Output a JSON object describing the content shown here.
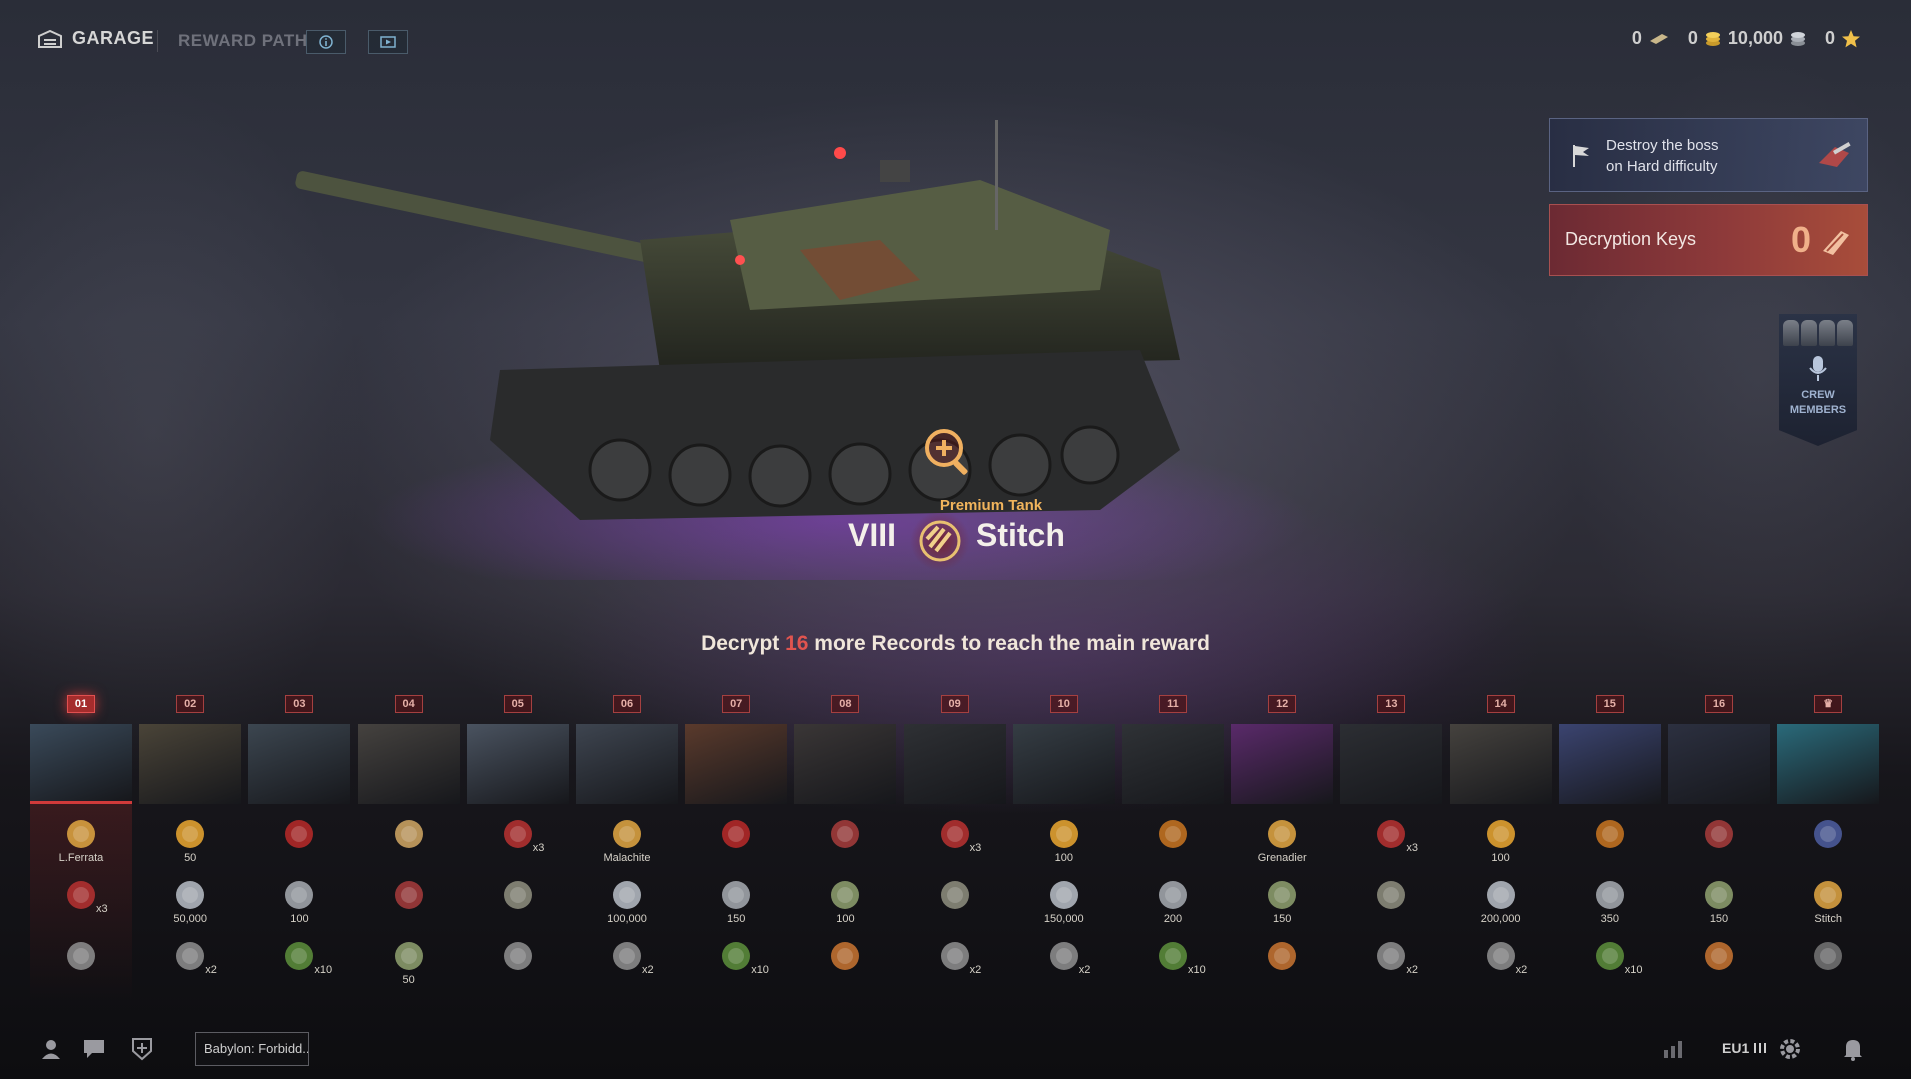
{
  "topbar": {
    "garage_label": "GARAGE",
    "reward_path_label": "REWARD PATH",
    "info_icon": "info-icon",
    "video_icon": "video-icon",
    "currencies": [
      {
        "name": "bonds",
        "value": "0",
        "icon": "bonds-icon"
      },
      {
        "name": "gold",
        "value": "0",
        "icon": "gold-icon"
      },
      {
        "name": "credits",
        "value": "10,000",
        "icon": "credits-icon"
      },
      {
        "name": "free-xp",
        "value": "0",
        "icon": "star-icon"
      }
    ]
  },
  "mission": {
    "text_line1": "Destroy the boss",
    "text_line2": "on Hard difficulty"
  },
  "decryption_keys": {
    "label": "Decryption Keys",
    "value": "0"
  },
  "crew": {
    "label_line1": "CREW",
    "label_line2": "MEMBERS"
  },
  "tank": {
    "kind": "Premium Tank",
    "tier": "VIII",
    "name": "Stitch"
  },
  "decrypt": {
    "prefix": "Decrypt ",
    "count": "16",
    "suffix": " more Records to reach the main reward"
  },
  "path": {
    "active_index": 0,
    "columns": [
      {
        "num": "01",
        "thumb": "#3a4a5a",
        "r1": {
          "icon": "tank-medal",
          "cap": "L.Ferrata",
          "mul": ""
        },
        "r2": {
          "icon": "booster",
          "cap": "",
          "mul": "x3"
        },
        "r3": {
          "icon": "tank-star",
          "cap": "",
          "mul": ""
        }
      },
      {
        "num": "02",
        "thumb": "#4a4438",
        "r1": {
          "icon": "gold-badge",
          "cap": "50",
          "mul": ""
        },
        "r2": {
          "icon": "credits",
          "cap": "50,000",
          "mul": ""
        },
        "r3": {
          "icon": "tank-star",
          "cap": "",
          "mul": "x2"
        }
      },
      {
        "num": "03",
        "thumb": "#3c4650",
        "r1": {
          "icon": "medal-1",
          "cap": "",
          "mul": ""
        },
        "r2": {
          "icon": "gear",
          "cap": "100",
          "mul": ""
        },
        "r3": {
          "icon": "battery",
          "cap": "",
          "mul": "x10"
        }
      },
      {
        "num": "04",
        "thumb": "#45423f",
        "r1": {
          "icon": "portrait",
          "cap": "",
          "mul": ""
        },
        "r2": {
          "icon": "book",
          "cap": "",
          "mul": ""
        },
        "r3": {
          "icon": "cash",
          "cap": "50",
          "mul": ""
        }
      },
      {
        "num": "05",
        "thumb": "#4a5360",
        "r1": {
          "icon": "booster",
          "cap": "",
          "mul": "x3"
        },
        "r2": {
          "icon": "manual",
          "cap": "",
          "mul": ""
        },
        "r3": {
          "icon": "tank-star",
          "cap": "",
          "mul": ""
        }
      },
      {
        "num": "06",
        "thumb": "#3e4550",
        "r1": {
          "icon": "tank-medal",
          "cap": "Malachite",
          "mul": ""
        },
        "r2": {
          "icon": "credits",
          "cap": "100,000",
          "mul": ""
        },
        "r3": {
          "icon": "tank-star",
          "cap": "",
          "mul": "x2"
        }
      },
      {
        "num": "07",
        "thumb": "#5a3a2c",
        "r1": {
          "icon": "medal-1",
          "cap": "",
          "mul": ""
        },
        "r2": {
          "icon": "gear",
          "cap": "150",
          "mul": ""
        },
        "r3": {
          "icon": "battery",
          "cap": "",
          "mul": "x10"
        }
      },
      {
        "num": "08",
        "thumb": "#3a3636",
        "r1": {
          "icon": "book",
          "cap": "",
          "mul": ""
        },
        "r2": {
          "icon": "cash",
          "cap": "100",
          "mul": ""
        },
        "r3": {
          "icon": "decal",
          "cap": "",
          "mul": ""
        }
      },
      {
        "num": "09",
        "thumb": "#2e3034",
        "r1": {
          "icon": "booster",
          "cap": "",
          "mul": "x3"
        },
        "r2": {
          "icon": "manual",
          "cap": "",
          "mul": ""
        },
        "r3": {
          "icon": "tank-star",
          "cap": "",
          "mul": "x2"
        }
      },
      {
        "num": "10",
        "thumb": "#353d44",
        "r1": {
          "icon": "gold-badge",
          "cap": "100",
          "mul": ""
        },
        "r2": {
          "icon": "credits",
          "cap": "150,000",
          "mul": ""
        },
        "r3": {
          "icon": "tank-star",
          "cap": "",
          "mul": "x2"
        }
      },
      {
        "num": "11",
        "thumb": "#2f3236",
        "r1": {
          "icon": "medal-2",
          "cap": "",
          "mul": ""
        },
        "r2": {
          "icon": "gear",
          "cap": "200",
          "mul": ""
        },
        "r3": {
          "icon": "battery",
          "cap": "",
          "mul": "x10"
        }
      },
      {
        "num": "12",
        "thumb": "#5a2a6a",
        "r1": {
          "icon": "tank-medal",
          "cap": "Grenadier",
          "mul": ""
        },
        "r2": {
          "icon": "cash",
          "cap": "150",
          "mul": ""
        },
        "r3": {
          "icon": "decal",
          "cap": "",
          "mul": ""
        }
      },
      {
        "num": "13",
        "thumb": "#2c2e33",
        "r1": {
          "icon": "booster",
          "cap": "",
          "mul": "x3"
        },
        "r2": {
          "icon": "manual",
          "cap": "",
          "mul": ""
        },
        "r3": {
          "icon": "tank-star",
          "cap": "",
          "mul": "x2"
        }
      },
      {
        "num": "14",
        "thumb": "#45423e",
        "r1": {
          "icon": "gold-badge",
          "cap": "100",
          "mul": ""
        },
        "r2": {
          "icon": "credits",
          "cap": "200,000",
          "mul": ""
        },
        "r3": {
          "icon": "tank-star",
          "cap": "",
          "mul": "x2"
        }
      },
      {
        "num": "15",
        "thumb": "#3b4470",
        "r1": {
          "icon": "medal-2",
          "cap": "",
          "mul": ""
        },
        "r2": {
          "icon": "gear",
          "cap": "350",
          "mul": ""
        },
        "r3": {
          "icon": "battery",
          "cap": "",
          "mul": "x10"
        }
      },
      {
        "num": "16",
        "thumb": "#2c3040",
        "r1": {
          "icon": "book",
          "cap": "",
          "mul": ""
        },
        "r2": {
          "icon": "cash",
          "cap": "150",
          "mul": ""
        },
        "r3": {
          "icon": "decal",
          "cap": "",
          "mul": ""
        }
      },
      {
        "num": "crown",
        "thumb": "#2a6a7a",
        "r1": {
          "icon": "emblem",
          "cap": "",
          "mul": ""
        },
        "r2": {
          "icon": "tank-medal",
          "cap": "Stitch",
          "mul": ""
        },
        "r3": {
          "icon": "camo",
          "cap": "",
          "mul": ""
        }
      }
    ]
  },
  "bottombar": {
    "profile_icon": "profile-icon",
    "chat_icon": "chat-icon",
    "platoon_icon": "platoon-icon",
    "mode_field": "Babylon: Forbidd...",
    "stats_icon": "stats-icon",
    "server": "EU1",
    "settings_icon": "gear-icon",
    "notifications_icon": "bell-icon"
  },
  "colors": {
    "accent_red": "#d03a3a",
    "gold": "#f1b45c",
    "keys_bg": "#8e3a3a",
    "mission_bg": "#404a68"
  }
}
